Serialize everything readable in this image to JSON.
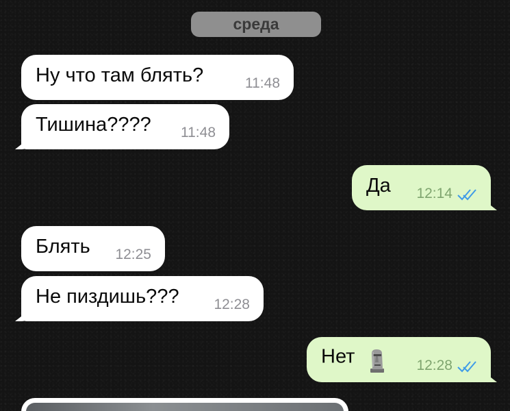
{
  "date_separator": "среда",
  "messages": [
    {
      "text": "Ну что там блять?",
      "time": "11:48",
      "direction": "incoming"
    },
    {
      "text": "Тишина????",
      "time": "11:48",
      "direction": "incoming"
    },
    {
      "text": "Да",
      "time": "12:14",
      "direction": "outgoing",
      "status": "read"
    },
    {
      "text": "Блять",
      "time": "12:25",
      "direction": "incoming"
    },
    {
      "text": "Не пиздишь???",
      "time": "12:28",
      "direction": "incoming"
    },
    {
      "text": "Нет",
      "emoji": "moai",
      "time": "12:28",
      "direction": "outgoing",
      "status": "read"
    }
  ],
  "colors": {
    "incoming_bubble": "#ffffff",
    "outgoing_bubble": "#dff7c8",
    "read_check": "#3f9be8",
    "date_pill": "#8f8f8f"
  }
}
